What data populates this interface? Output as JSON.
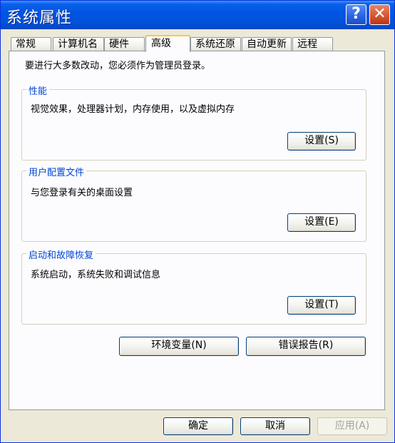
{
  "window": {
    "title": "系统属性"
  },
  "tabs": [
    {
      "label": "常规"
    },
    {
      "label": "计算机名"
    },
    {
      "label": "硬件"
    },
    {
      "label": "高级",
      "active": true
    },
    {
      "label": "系统还原"
    },
    {
      "label": "自动更新"
    },
    {
      "label": "远程"
    }
  ],
  "admin_note": "要进行大多数改动，您必须作为管理员登录。",
  "performance": {
    "title": "性能",
    "description": "视觉效果，处理器计划，内存使用，以及虚拟内存",
    "button": "设置(S)"
  },
  "user_profiles": {
    "title": "用户配置文件",
    "description": "与您登录有关的桌面设置",
    "button": "设置(E)"
  },
  "startup_recovery": {
    "title": "启动和故障恢复",
    "description": "系统启动，系统失败和调试信息",
    "button": "设置(T)"
  },
  "env_button": "环境变量(N)",
  "error_report_button": "错误报告(R)",
  "footer": {
    "ok": "确定",
    "cancel": "取消",
    "apply": "应用(A)"
  },
  "colors": {
    "titlebar": "#0054e3",
    "group_title": "#0046d5",
    "active_tab_accent": "#ffc83c",
    "dialog_bg": "#ece9d8"
  }
}
